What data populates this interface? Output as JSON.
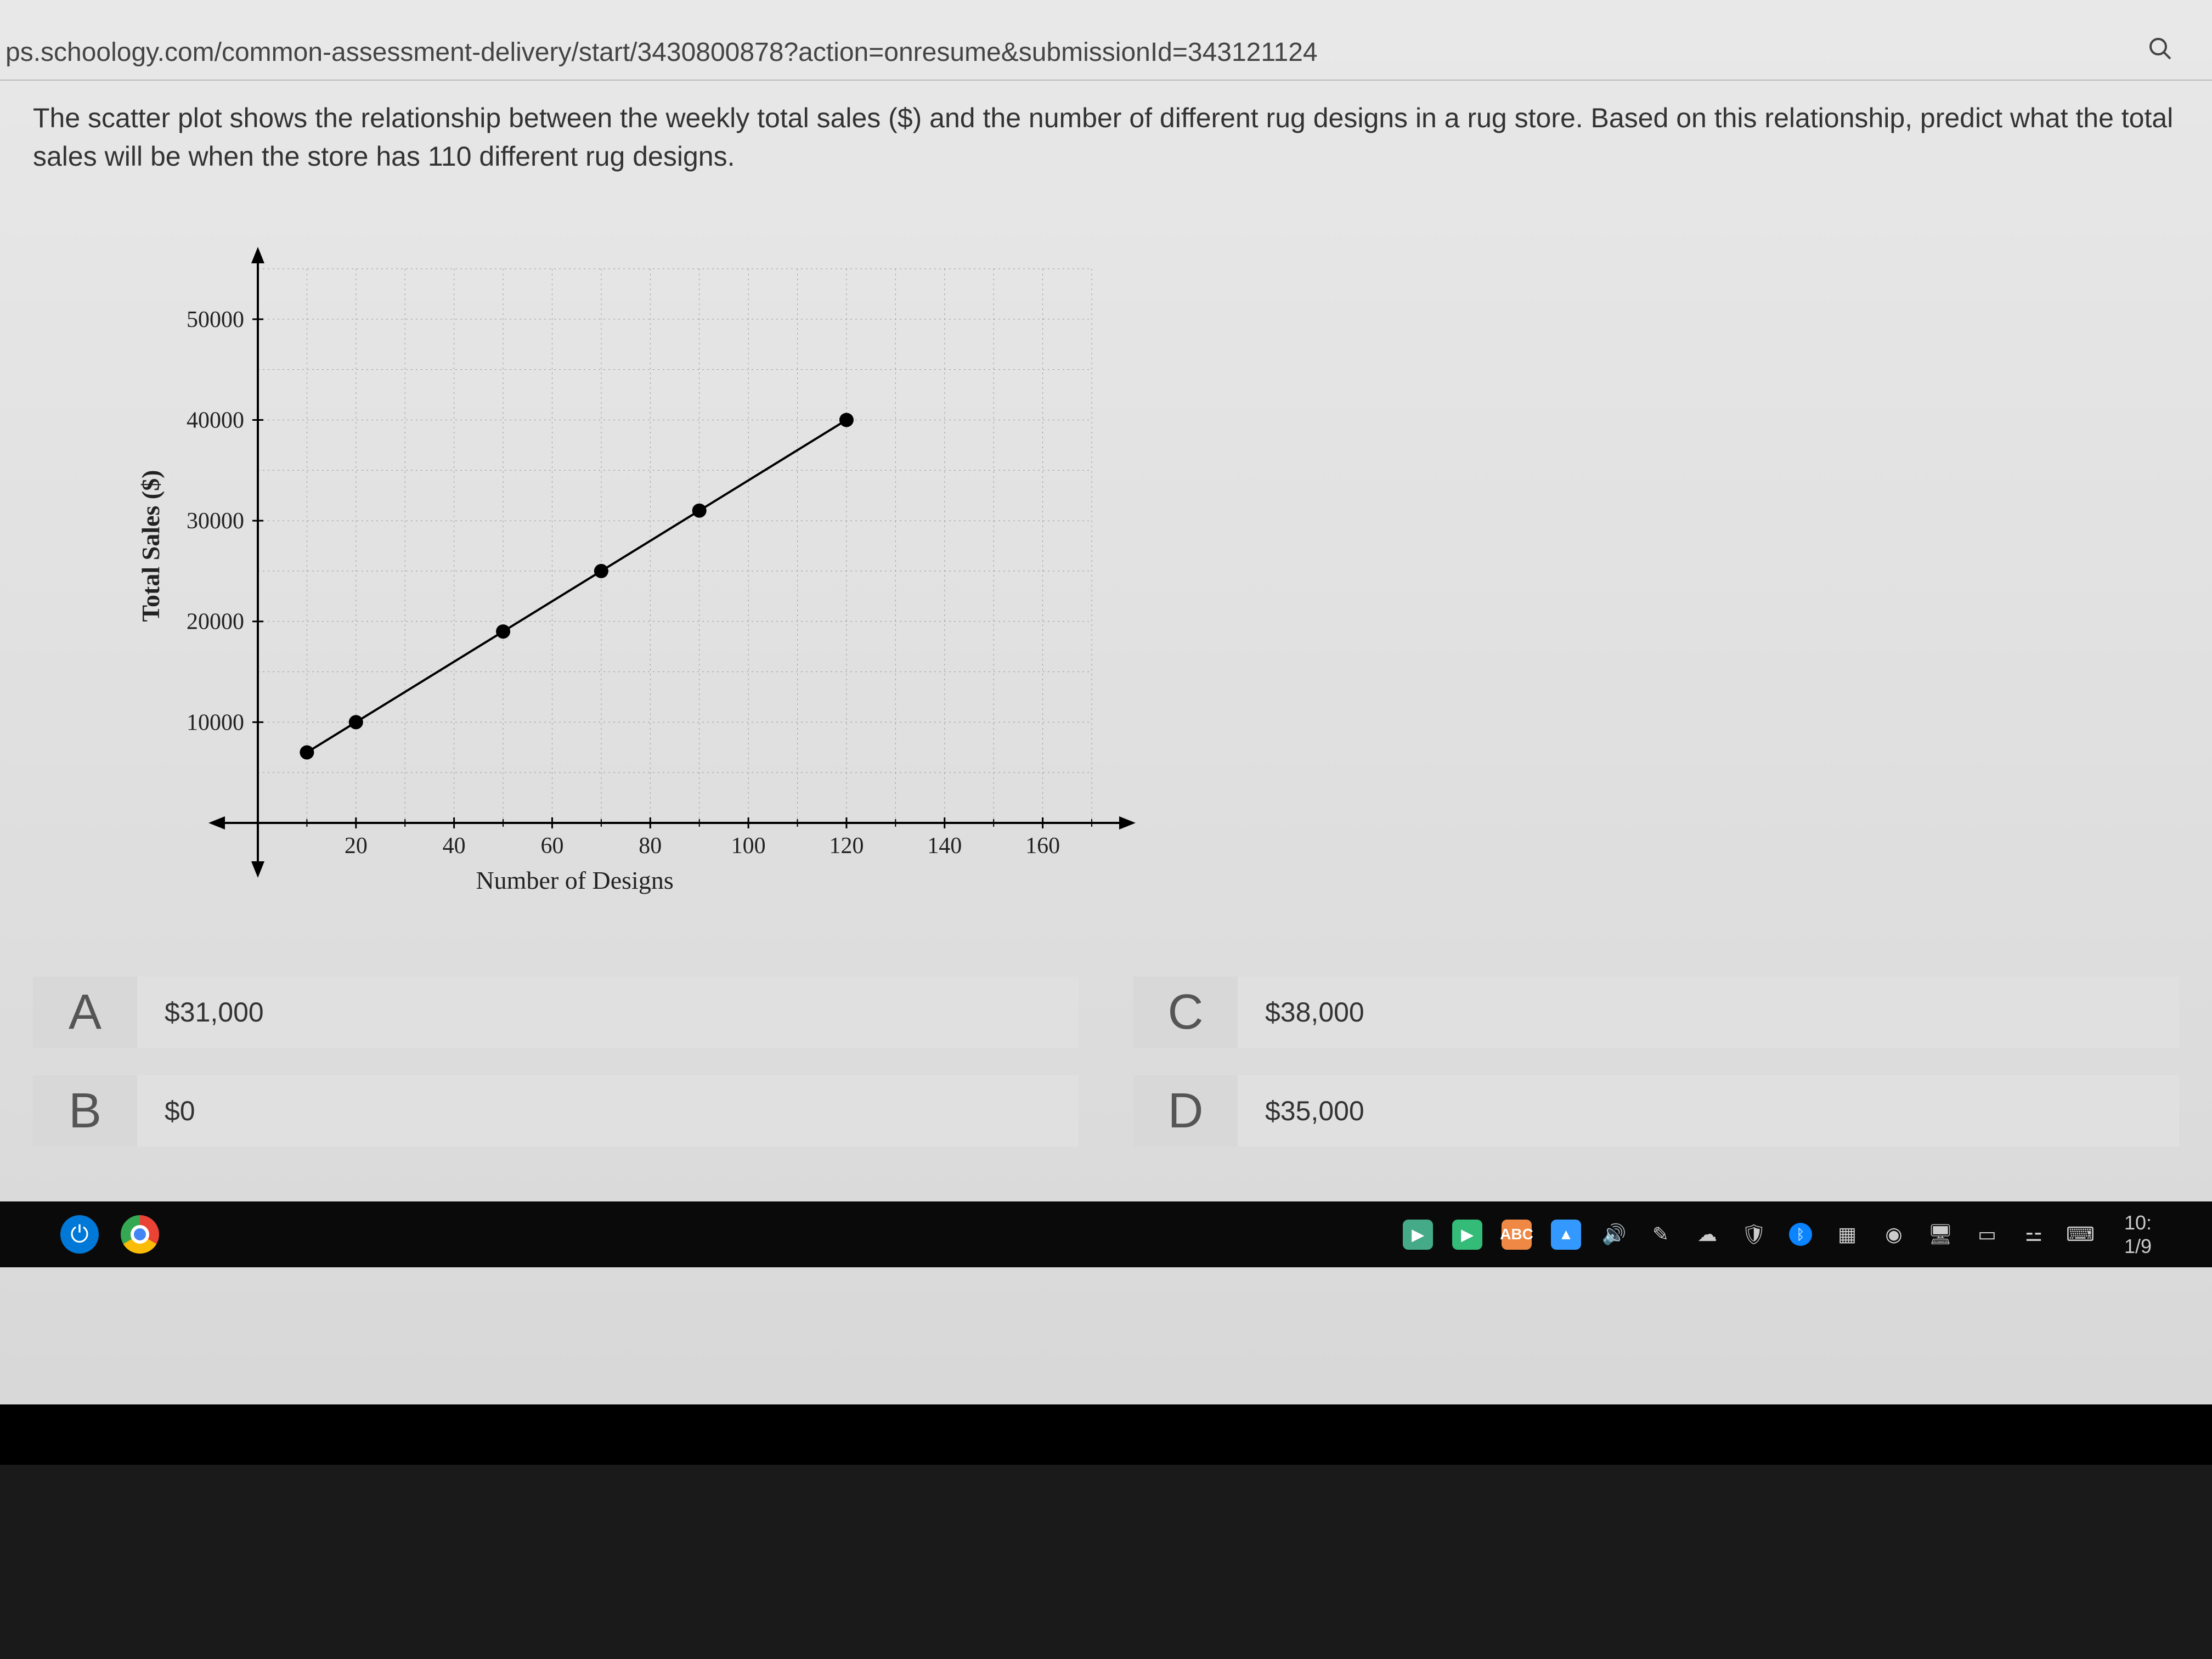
{
  "url": "ps.schoology.com/common-assessment-delivery/start/3430800878?action=onresume&submissionId=343121124",
  "question": "The scatter plot shows the relationship between the weekly total sales ($) and the number of different rug designs in a rug store. Based on this relationship, predict what the total sales will be when the store has 110 different rug designs.",
  "answers": {
    "A": {
      "letter": "A",
      "text": "$31,000"
    },
    "B": {
      "letter": "B",
      "text": "$0"
    },
    "C": {
      "letter": "C",
      "text": "$38,000"
    },
    "D": {
      "letter": "D",
      "text": "$35,000"
    }
  },
  "taskbar": {
    "time1": "10:",
    "time2": "1/9"
  },
  "chart_data": {
    "type": "scatter",
    "title": "",
    "xlabel": "Number of Designs",
    "ylabel": "Total Sales ($)",
    "xlim": [
      0,
      170
    ],
    "ylim": [
      0,
      55000
    ],
    "x_ticks": [
      20,
      40,
      60,
      80,
      100,
      120,
      140,
      160
    ],
    "y_ticks": [
      10000,
      20000,
      30000,
      40000,
      50000
    ],
    "points": [
      {
        "x": 10,
        "y": 7000
      },
      {
        "x": 20,
        "y": 10000
      },
      {
        "x": 50,
        "y": 19000
      },
      {
        "x": 70,
        "y": 25000
      },
      {
        "x": 90,
        "y": 31000
      },
      {
        "x": 120,
        "y": 40000
      }
    ],
    "trend_line": {
      "x1": 10,
      "y1": 7000,
      "x2": 120,
      "y2": 40000
    }
  }
}
